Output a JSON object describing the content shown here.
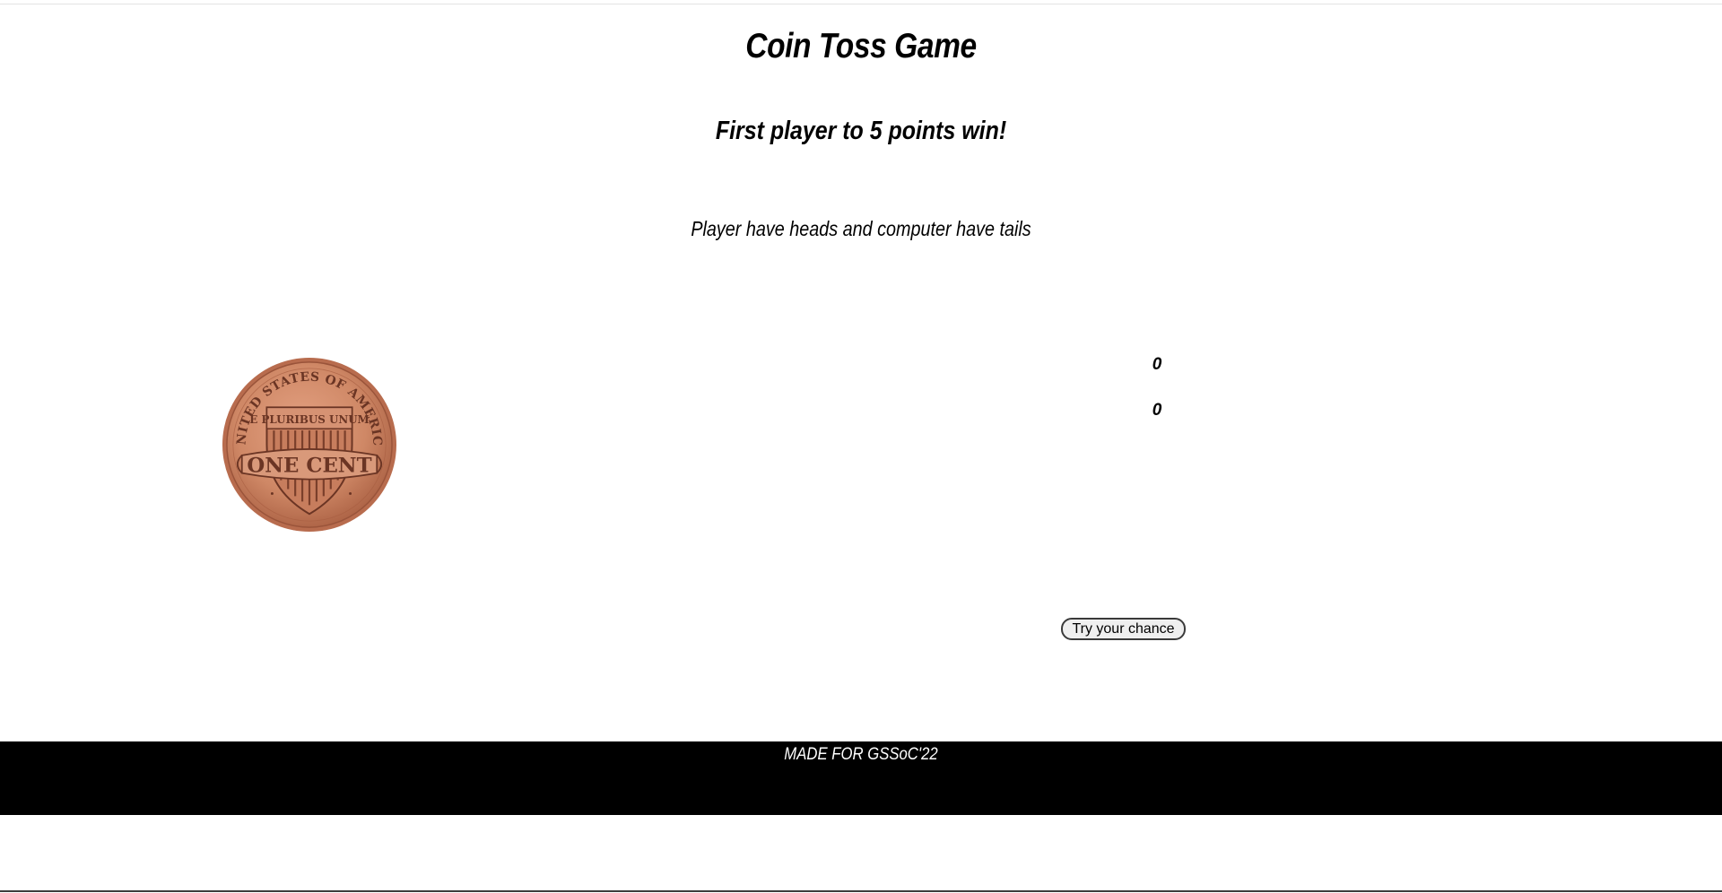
{
  "game": {
    "title": "Coin Toss Game",
    "subtitle": "First player to 5 points win!",
    "rules": "Player have heads and computer have tails"
  },
  "coin": {
    "icon": "penny-icon",
    "top_text": "UNITED STATES OF AMERICA",
    "motto": "E PLURIBUS UNUM",
    "denomination": "ONE CENT",
    "colors": {
      "outer": "#b86c4e",
      "face": "#d08a68",
      "shield": "#c77d5d",
      "lines": "#6b3524"
    }
  },
  "scores": {
    "player": "0",
    "computer": "0"
  },
  "controls": {
    "toss_button_label": "Try your chance"
  },
  "footer": {
    "text": "MADE FOR GSSoC'22"
  }
}
